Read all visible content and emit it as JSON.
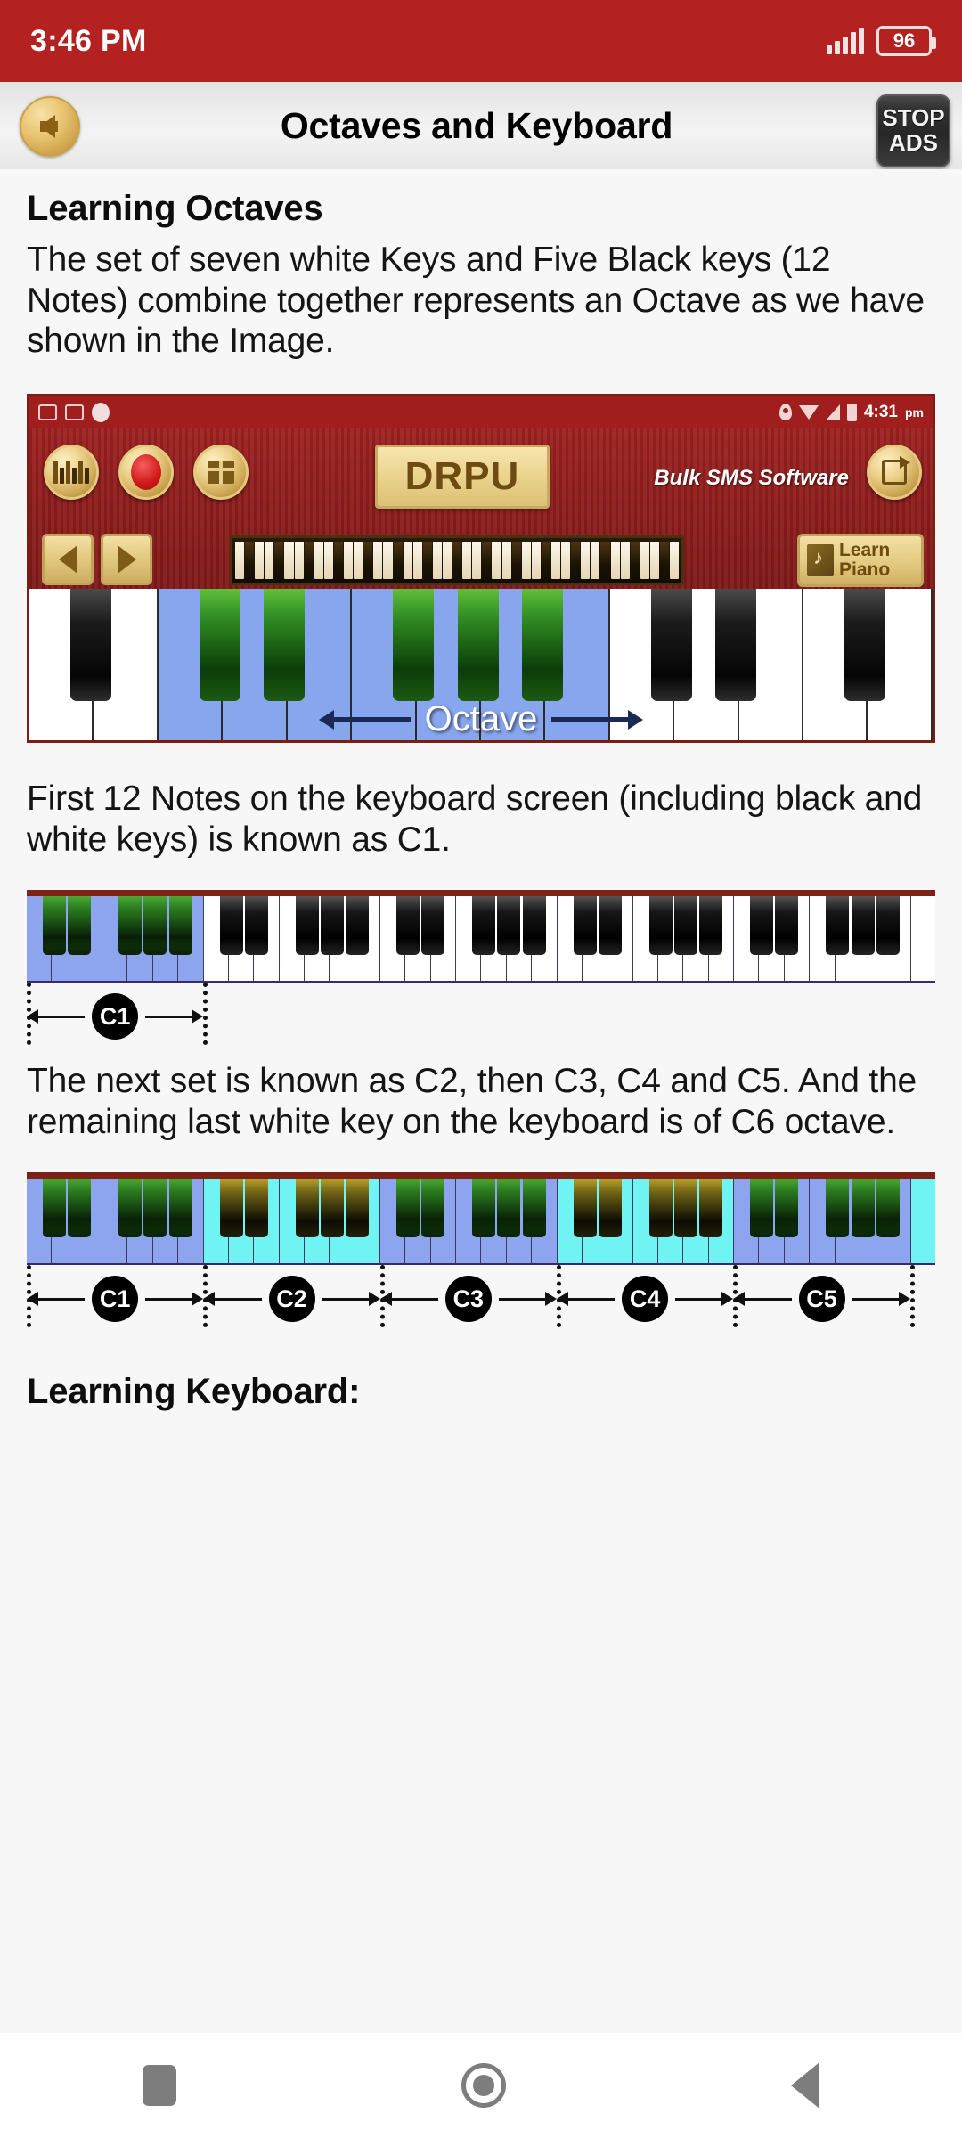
{
  "status_bar": {
    "time": "3:46 PM",
    "battery_level": "96",
    "signal_icon": "signal-bars-icon",
    "battery_icon": "battery-icon"
  },
  "app_bar": {
    "title": "Octaves and Keyboard",
    "back_icon": "back-arrow-icon",
    "stop_ads_line1": "STOP",
    "stop_ads_line2": "ADS"
  },
  "content": {
    "heading_1": "Learning Octaves",
    "paragraph_1": "The set of seven white Keys and Five Black keys (12 Notes) combine together represents an Octave as we have shown in the Image.",
    "paragraph_2": "First 12 Notes on the keyboard screen (including black and white keys) is known as C1.",
    "paragraph_3": "The next set is known as C2, then C3, C4 and C5. And the remaining last white key on the keyboard is of C6 octave.",
    "heading_2": "Learning Keyboard:"
  },
  "figure_app": {
    "app_status_time": "4:31",
    "app_status_ampm": "pm",
    "brand_label": "DRPU",
    "bulk_label": "Bulk SMS Software",
    "learn_label_1": "Learn",
    "learn_label_2": "Piano",
    "octave_label": "Octave",
    "icons": {
      "piano_keys": "piano-keys-icon",
      "record": "record-icon",
      "gift": "gift-icon",
      "share": "share-icon",
      "prev": "prev-arrow-icon",
      "next": "next-arrow-icon",
      "book": "music-book-icon",
      "location": "location-pin-icon",
      "wifi": "wifi-icon",
      "signal": "signal-triangle-icon",
      "battery": "battery-icon"
    }
  },
  "figure_c1": {
    "labels": [
      "C1"
    ],
    "highlight_color": "#8da4ef",
    "total_white_keys": 36,
    "highlighted_white_keys": 7
  },
  "figure_octaves": {
    "labels": [
      "C1",
      "C2",
      "C3",
      "C4",
      "C5"
    ],
    "octave_colors": [
      "#8da4ef",
      "#6ff3f3",
      "#8da4ef",
      "#6ff3f3",
      "#8da4ef"
    ],
    "last_key_color": "#6ff3f3",
    "total_white_keys": 36,
    "keys_per_octave": 7
  },
  "nav_bar": {
    "recent_icon": "recent-apps-icon",
    "home_icon": "home-icon",
    "back_icon": "back-triangle-icon"
  }
}
